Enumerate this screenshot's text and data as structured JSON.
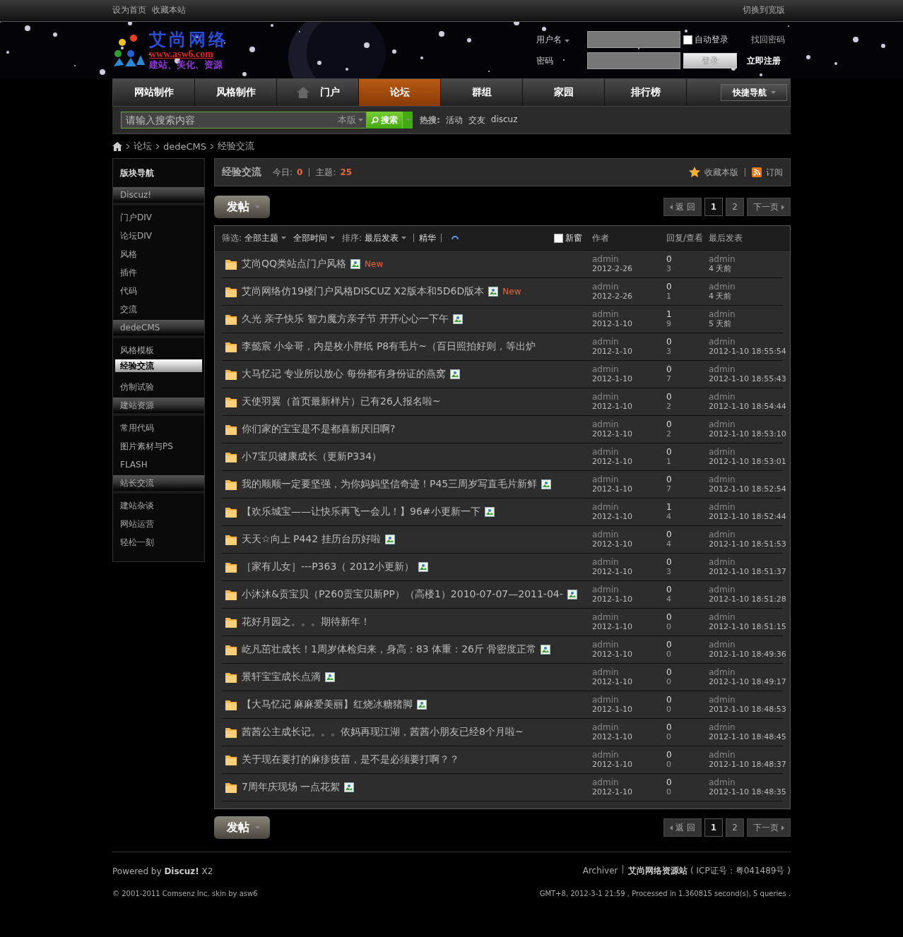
{
  "topbar": {
    "links": [
      "设为首页",
      "收藏本站"
    ],
    "wide_link": "切换到宽版"
  },
  "logo": {
    "title": "艾尚网络",
    "url": "www.asw6.com",
    "slogan": "建站、美化、资源"
  },
  "login": {
    "username_label": "用户名",
    "password_label": "密码",
    "auto_login": {
      "label": "自动登录",
      "checked": false
    },
    "forgot": "找回密码",
    "login_button": "登录",
    "register": "立即注册"
  },
  "nav": {
    "items": [
      {
        "label": "网站制作",
        "selected": false,
        "home_icon": false
      },
      {
        "label": "风格制作",
        "selected": false,
        "home_icon": false
      },
      {
        "label": "门户",
        "selected": false,
        "home_icon": true
      },
      {
        "label": "论坛",
        "selected": true,
        "home_icon": false
      },
      {
        "label": "群组",
        "selected": false,
        "home_icon": false
      },
      {
        "label": "家园",
        "selected": false,
        "home_icon": false
      },
      {
        "label": "排行榜",
        "selected": false,
        "home_icon": false
      }
    ],
    "quick_nav": "快捷导航"
  },
  "search": {
    "placeholder": "请输入搜索内容",
    "scope": "本版",
    "button": "搜索",
    "hot_label": "热搜:",
    "hot": [
      "活动",
      "交友",
      "discuz"
    ]
  },
  "breadcrumb": [
    "论坛",
    "dedeCMS",
    "经验交流"
  ],
  "sidebar": {
    "title": "版块导航",
    "groups": [
      {
        "label": "Discuz!",
        "children": [
          {
            "label": "门户DIV",
            "selected": false
          },
          {
            "label": "论坛DIV",
            "selected": false
          },
          {
            "label": "风格",
            "selected": false
          },
          {
            "label": "插件",
            "selected": false
          },
          {
            "label": "代码",
            "selected": false
          },
          {
            "label": "交流",
            "selected": false
          }
        ]
      },
      {
        "label": "dedeCMS",
        "children": [
          {
            "label": "风格模板",
            "selected": false
          },
          {
            "label": "经验交流",
            "selected": true
          },
          {
            "label": "仿制试验",
            "selected": false
          }
        ]
      },
      {
        "label": "建站资源",
        "children": [
          {
            "label": "常用代码",
            "selected": false
          },
          {
            "label": "图片素材与PS",
            "selected": false
          },
          {
            "label": "FLASH",
            "selected": false
          }
        ]
      },
      {
        "label": "站长交流",
        "children": [
          {
            "label": "建站杂谈",
            "selected": false
          },
          {
            "label": "网站运营",
            "selected": false
          },
          {
            "label": "轻松一刻",
            "selected": false
          }
        ]
      }
    ]
  },
  "forum": {
    "title": "经验交流",
    "today_label": "今日:",
    "today": "0",
    "topics_label": "主题:",
    "topics": "25",
    "favorite": "收藏本版",
    "subscribe": "订阅"
  },
  "post_button": "发帖",
  "pager": {
    "back": "返 回",
    "pages": [
      {
        "label": "1",
        "selected": true
      },
      {
        "label": "2",
        "selected": false
      }
    ],
    "next": "下一页"
  },
  "filters": {
    "filter_label": "筛选:",
    "type": "全部主题",
    "time": "全部时间",
    "sort_label": "排序:",
    "sort": "最后发表",
    "digest": "精华",
    "new_window": {
      "label": "新窗",
      "checked": false
    },
    "columns": [
      "作者",
      "回复/查看",
      "最后发表"
    ]
  },
  "threads": [
    {
      "title": "艾尚QQ类站点门户风格",
      "has_image": true,
      "new_label": "New",
      "author": "admin",
      "date": "2012-2-26",
      "replies": "0",
      "views": "3",
      "last_author": "admin",
      "last_time": "4 天前"
    },
    {
      "title": "艾尚网络仿19楼门户风格DISCUZ X2版本和5D6D版本",
      "has_image": true,
      "new_label": "New",
      "author": "admin",
      "date": "2012-2-26",
      "replies": "0",
      "views": "1",
      "last_author": "admin",
      "last_time": "4 天前"
    },
    {
      "title": "久光 亲子快乐 智力魔方亲子节 开开心心一下午",
      "has_image": true,
      "author": "admin",
      "date": "2012-1-10",
      "replies": "1",
      "views": "9",
      "last_author": "admin",
      "last_time": "5 天前"
    },
    {
      "title": "李懿宸 小伞哥，内是枚小胖纸 P8有毛片~（百日照拍好则，等出炉",
      "has_image": false,
      "author": "admin",
      "date": "2012-1-10",
      "replies": "0",
      "views": "3",
      "last_author": "admin",
      "last_time": "2012-1-10 18:55:54"
    },
    {
      "title": "大马忆记 专业所以放心 每份都有身份证的燕窝",
      "has_image": true,
      "author": "admin",
      "date": "2012-1-10",
      "replies": "0",
      "views": "7",
      "last_author": "admin",
      "last_time": "2012-1-10 18:55:43"
    },
    {
      "title": "天使羽翼（首页最新样片）已有26人报名啦~",
      "has_image": false,
      "author": "admin",
      "date": "2012-1-10",
      "replies": "0",
      "views": "2",
      "last_author": "admin",
      "last_time": "2012-1-10 18:54:44"
    },
    {
      "title": "你们家的宝宝是不是都喜新厌旧啊?",
      "has_image": false,
      "author": "admin",
      "date": "2012-1-10",
      "replies": "0",
      "views": "2",
      "last_author": "admin",
      "last_time": "2012-1-10 18:53:10"
    },
    {
      "title": "小7宝贝健康成长（更新P334）",
      "has_image": false,
      "author": "admin",
      "date": "2012-1-10",
      "replies": "0",
      "views": "1",
      "last_author": "admin",
      "last_time": "2012-1-10 18:53:01"
    },
    {
      "title": "我的顺顺一定要坚强，为你妈妈坚信奇迹！P45三周岁写直毛片新鲜",
      "has_image": true,
      "author": "admin",
      "date": "2012-1-10",
      "replies": "0",
      "views": "7",
      "last_author": "admin",
      "last_time": "2012-1-10 18:52:54"
    },
    {
      "title": "【欢乐城宝——让快乐再飞一会儿！】96#小更新一下",
      "has_image": true,
      "author": "admin",
      "date": "2012-1-10",
      "replies": "1",
      "views": "4",
      "last_author": "admin",
      "last_time": "2012-1-10 18:52:44"
    },
    {
      "title": "天天☆向上 P442 挂历台历好啦",
      "has_image": true,
      "author": "admin",
      "date": "2012-1-10",
      "replies": "0",
      "views": "4",
      "last_author": "admin",
      "last_time": "2012-1-10 18:51:53"
    },
    {
      "title": "［家有儿女］---P363（ 2012小更新）",
      "has_image": true,
      "author": "admin",
      "date": "2012-1-10",
      "replies": "0",
      "views": "3",
      "last_author": "admin",
      "last_time": "2012-1-10 18:51:37"
    },
    {
      "title": "小沐沐&贡宝贝（P260贡宝贝新PP）（高楼1）2010-07-07—2011-04-",
      "has_image": true,
      "author": "admin",
      "date": "2012-1-10",
      "replies": "0",
      "views": "4",
      "last_author": "admin",
      "last_time": "2012-1-10 18:51:28"
    },
    {
      "title": "花好月园之。。。期待新年！",
      "has_image": false,
      "author": "admin",
      "date": "2012-1-10",
      "replies": "0",
      "views": "0",
      "last_author": "admin",
      "last_time": "2012-1-10 18:51:15"
    },
    {
      "title": "屹凡茁壮成长！1周岁体检归来，身高：83 体重：26斤 骨密度正常",
      "has_image": true,
      "author": "admin",
      "date": "2012-1-10",
      "replies": "0",
      "views": "0",
      "last_author": "admin",
      "last_time": "2012-1-10 18:49:36"
    },
    {
      "title": "景轩宝宝成长点滴",
      "has_image": true,
      "author": "admin",
      "date": "2012-1-10",
      "replies": "0",
      "views": "0",
      "last_author": "admin",
      "last_time": "2012-1-10 18:49:17"
    },
    {
      "title": "【大马忆记 麻麻爱美丽】红烧冰糖猪脚",
      "has_image": true,
      "author": "admin",
      "date": "2012-1-10",
      "replies": "0",
      "views": "0",
      "last_author": "admin",
      "last_time": "2012-1-10 18:48:53"
    },
    {
      "title": "茜茜公主成长记。。。依妈再现江湖，茜茜小朋友已经8个月啦~",
      "has_image": false,
      "author": "admin",
      "date": "2012-1-10",
      "replies": "0",
      "views": "0",
      "last_author": "admin",
      "last_time": "2012-1-10 18:48:45"
    },
    {
      "title": "关于现在要打的麻疹疫苗，是不是必须要打啊？？",
      "has_image": false,
      "author": "admin",
      "date": "2012-1-10",
      "replies": "0",
      "views": "0",
      "last_author": "admin",
      "last_time": "2012-1-10 18:48:37"
    },
    {
      "title": "7周年庆现场 一点花絮",
      "has_image": true,
      "author": "admin",
      "date": "2012-1-10",
      "replies": "0",
      "views": "0",
      "last_author": "admin",
      "last_time": "2012-1-10 18:48:35"
    }
  ],
  "bottom_post_button": "发帖",
  "bottom_pager": {
    "back": "返 回",
    "pages": [
      {
        "label": "1",
        "selected": true
      },
      {
        "label": "2",
        "selected": false
      }
    ],
    "next": "下一页"
  },
  "footer": {
    "powered": "Powered by **Discuz!** X2",
    "archiver": "Archiver",
    "site_name": "艾尚网络资源站",
    "icp": "( ICP证号：粤041489号 )",
    "copyright": "© 2001-2011 Comsenz Inc. skin by asw6",
    "stats": "GMT+8, 2012-3-1 21:59 , Processed in 1.360815 second(s), 5 queries ."
  }
}
